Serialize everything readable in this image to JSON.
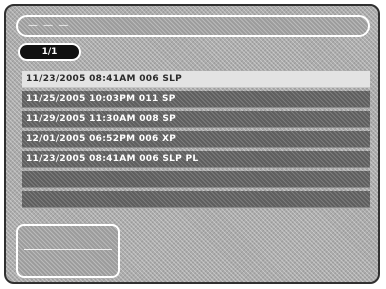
{
  "title_bar": {
    "text": "— — —"
  },
  "pager": {
    "label": "1/1"
  },
  "recordings": [
    {
      "label": "11/23/2005 08:41AM 006 SLP",
      "selected": true
    },
    {
      "label": "11/25/2005 10:03PM 011 SP",
      "selected": false
    },
    {
      "label": "11/29/2005 11:30AM 008 SP",
      "selected": false
    },
    {
      "label": "12/01/2005 06:52PM 006 XP",
      "selected": false
    },
    {
      "label": "11/23/2005 08:41AM 006 SLP PL",
      "selected": false
    },
    {
      "label": "",
      "selected": false
    },
    {
      "label": "",
      "selected": false
    }
  ],
  "colors": {
    "selected_row": "#e3e3e3",
    "row": "#5e5e5e",
    "pager_bg": "#111111"
  }
}
